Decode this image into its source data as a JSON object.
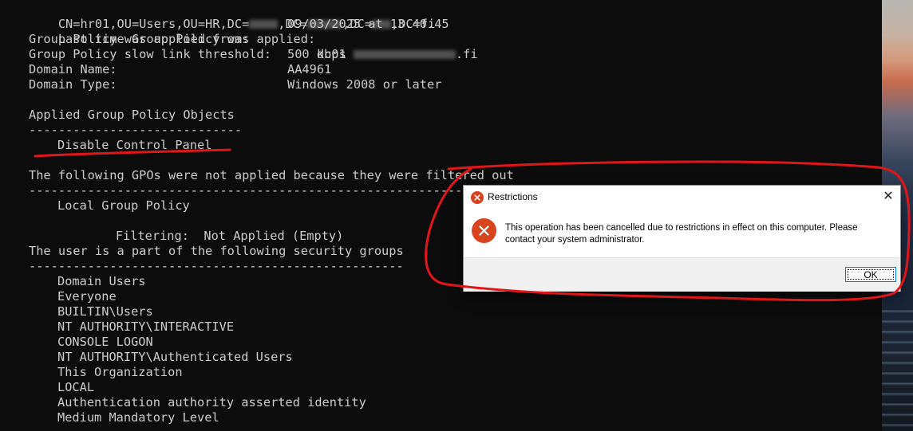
{
  "console": {
    "lines": [
      {
        "label": "CN=hr01,OU=Users,OU=HR,DC=",
        "parts": [
          ",DC=",
          ",DC=",
          ",DC=fi"
        ]
      },
      {
        "label": "Last time Group Policy was applied:",
        "value": "09/03/2025 at 13.40.45"
      },
      {
        "label": "Group Policy was applied from:",
        "value_prefix": "dc01",
        "value_suffix": ".fi"
      },
      {
        "label": "Group Policy slow link threshold:",
        "value": "500 kbps"
      },
      {
        "label": "Domain Name:",
        "value": "AA4961"
      },
      {
        "label": "Domain Type:",
        "value": "Windows 2008 or later"
      }
    ],
    "applied_gpo_header": "Applied Group Policy Objects",
    "applied_gpo_rule": "-----------------------------",
    "applied_gpos": [
      "Disable Control Panel"
    ],
    "filtered_header": "The following GPOs were not applied because they were filtered out",
    "filtered_rule": "-------------------------------------------------------------------",
    "filtered_gpo": "Local Group Policy",
    "filtering_label": "Filtering:",
    "filtering_value": "Not Applied (Empty)",
    "groups_header": "The user is a part of the following security groups",
    "groups_rule": "---------------------------------------------------",
    "groups": [
      "Domain Users",
      "Everyone",
      "BUILTIN\\Users",
      "NT AUTHORITY\\INTERACTIVE",
      "CONSOLE LOGON",
      "NT AUTHORITY\\Authenticated Users",
      "This Organization",
      "LOCAL",
      "Authentication authority asserted identity",
      "Medium Mandatory Level"
    ]
  },
  "dialog": {
    "title": "Restrictions",
    "message": "This operation has been cancelled due to restrictions in effect on this computer. Please contact your system administrator.",
    "ok_label": "OK",
    "close_glyph": "✕",
    "icon": "error-icon",
    "icon_color": "#d8401f"
  },
  "colors": {
    "console_bg": "#0c0c0c",
    "console_text": "#cccccc",
    "annotation": "#e0161b"
  }
}
